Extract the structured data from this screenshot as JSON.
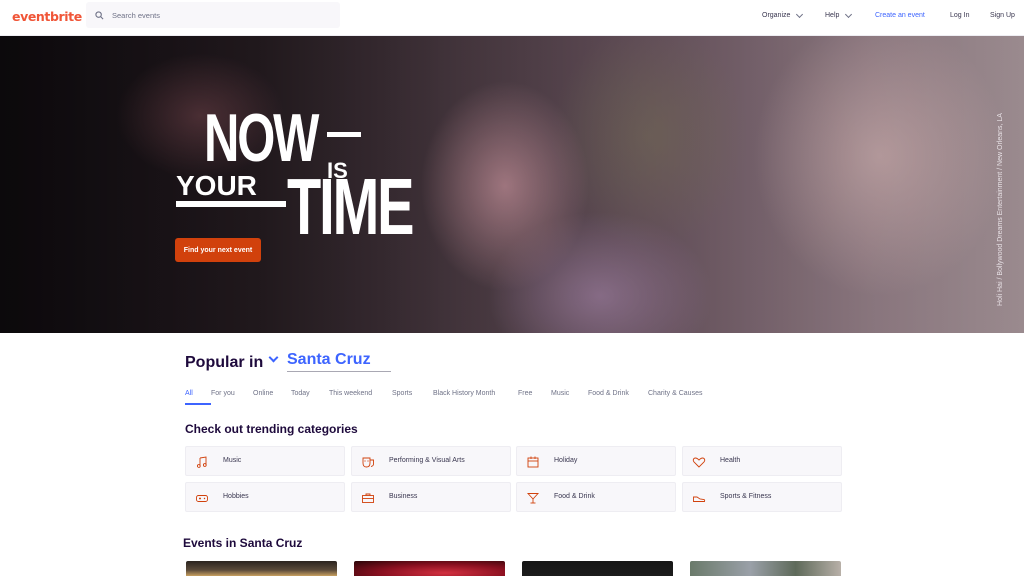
{
  "header": {
    "logo": "eventbrite",
    "search_placeholder": "Search events",
    "nav": {
      "organize": "Organize",
      "help": "Help",
      "create": "Create an event",
      "login": "Log In",
      "signup": "Sign Up"
    }
  },
  "hero": {
    "headline_now": "NOW",
    "headline_is": "IS",
    "headline_your": "YOUR",
    "headline_time": "TIME",
    "cta": "Find your next event",
    "credit": "Holi Hai / Bollywood Dreams Entertainment / New Orleans, LA"
  },
  "popular": {
    "label": "Popular in",
    "location": "Santa Cruz"
  },
  "tabs": [
    "All",
    "For you",
    "Online",
    "Today",
    "This weekend",
    "Sports",
    "Black History Month",
    "Free",
    "Music",
    "Food & Drink",
    "Charity & Causes"
  ],
  "trending": {
    "title": "Check out trending categories",
    "categories": [
      {
        "label": "Music",
        "icon": "music-icon"
      },
      {
        "label": "Performing & Visual Arts",
        "icon": "theater-masks-icon"
      },
      {
        "label": "Holiday",
        "icon": "calendar-icon"
      },
      {
        "label": "Health",
        "icon": "heart-icon"
      },
      {
        "label": "Hobbies",
        "icon": "gamepad-icon"
      },
      {
        "label": "Business",
        "icon": "briefcase-icon"
      },
      {
        "label": "Food & Drink",
        "icon": "cocktail-icon"
      },
      {
        "label": "Sports & Fitness",
        "icon": "sneaker-icon"
      }
    ]
  },
  "events": {
    "title": "Events in Santa Cruz"
  },
  "colors": {
    "brand": "#f05537",
    "accent": "#3d64ff",
    "cta": "#d1410c",
    "icon": "#d1410c"
  }
}
